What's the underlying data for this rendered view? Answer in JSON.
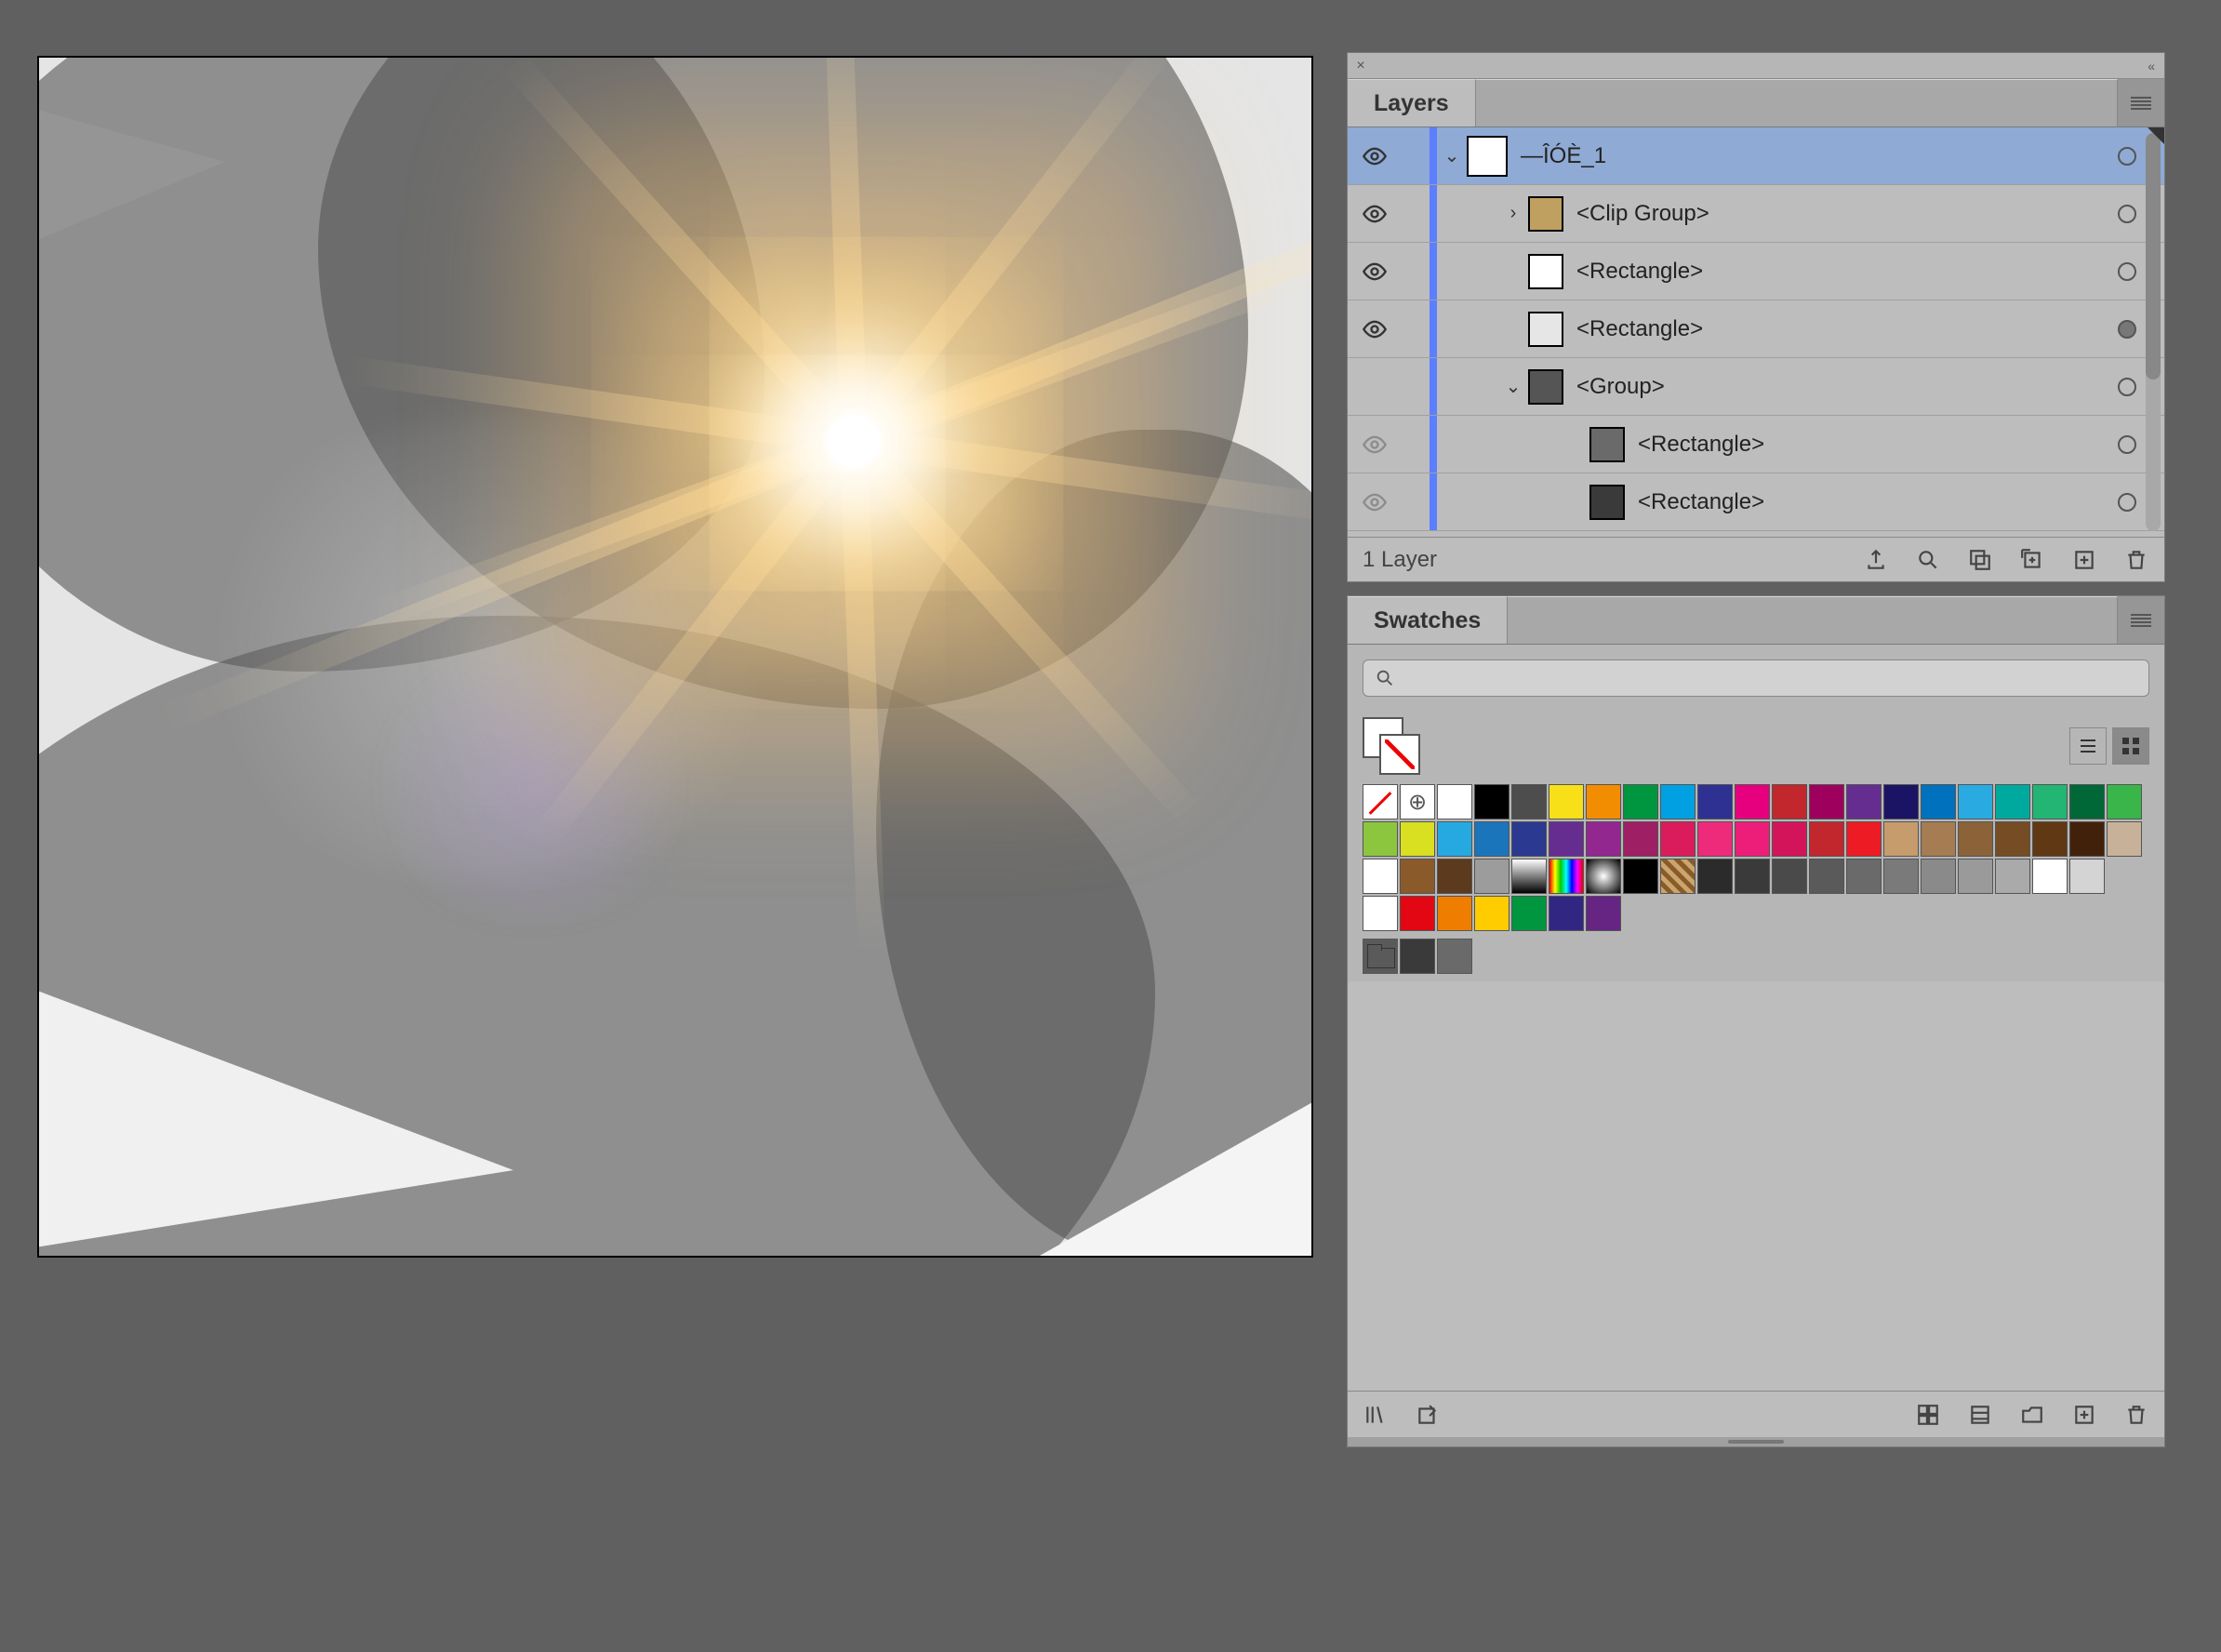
{
  "panels": {
    "layers": {
      "tab_label": "Layers",
      "footer_text": "1 Layer",
      "rows": [
        {
          "name": "—ÎÓÈ_1",
          "indent": 0,
          "disclosure": "open",
          "visible": true,
          "target": "empty",
          "selected": true,
          "thumb": "#ffffff"
        },
        {
          "name": "<Clip Group>",
          "indent": 1,
          "disclosure": "closed",
          "visible": true,
          "target": "empty",
          "selected": false,
          "thumb": "#c0a060"
        },
        {
          "name": "<Rectangle>",
          "indent": 1,
          "disclosure": "none",
          "visible": true,
          "target": "empty",
          "selected": false,
          "thumb": "#ffffff"
        },
        {
          "name": "<Rectangle>",
          "indent": 1,
          "disclosure": "none",
          "visible": true,
          "target": "filled",
          "selected": false,
          "thumb": "#e6e6e6"
        },
        {
          "name": "<Group>",
          "indent": 1,
          "disclosure": "open",
          "visible": false,
          "target": "empty",
          "selected": false,
          "thumb": "#555555"
        },
        {
          "name": "<Rectangle>",
          "indent": 2,
          "disclosure": "none",
          "visible": "dim",
          "target": "empty",
          "selected": false,
          "thumb": "#6a6a6a"
        },
        {
          "name": "<Rectangle>",
          "indent": 2,
          "disclosure": "none",
          "visible": "dim",
          "target": "empty",
          "selected": false,
          "thumb": "#3a3a3a"
        }
      ]
    },
    "swatches": {
      "tab_label": "Swatches",
      "search_placeholder": "",
      "colors_row1": [
        "none",
        "reg",
        "#ffffff",
        "#000000",
        "#4d4d4d",
        "#f7e017",
        "#f28c00",
        "#009640",
        "#00a0e3",
        "#2e3192",
        "#e6007e",
        "#c1272d",
        "#9e005d",
        "#662d91",
        "#1b1464",
        "#0071bc",
        "#29abe2",
        "#00a99d",
        "#22b573",
        "#006837",
        "#39b54a"
      ],
      "colors_row2": [
        "#8cc63f",
        "#d9e021",
        "#26a9e0",
        "#1b75bb",
        "#2b3990",
        "#662d91",
        "#92278f",
        "#9e1f63",
        "#da1c5c",
        "#ee2a7b",
        "#ed1e79",
        "#d4145a",
        "#c1272d",
        "#ed1c24",
        "#c69c6d",
        "#a67c52",
        "#8c6239",
        "#754c24",
        "#603813",
        "#42210b",
        "#c7b299"
      ],
      "colors_row3": [
        "#ffffff",
        "#8b5a2b",
        "#5c3a1e",
        "#9c9c9c",
        "grad1",
        "grad2",
        "grad3",
        "#000000",
        "pat",
        "#2b2b2b",
        "#3a3a3a",
        "#4a4a4a",
        "#5a5a5a",
        "#6a6a6a",
        "#7a7a7a",
        "#8a8a8a",
        "#9a9a9a",
        "#aaaaaa",
        "#ffffff",
        "#d4d4d4"
      ],
      "colors_row4": [
        "#ffffff",
        "#e30613",
        "#ef7d00",
        "#ffcc00",
        "#009640",
        "#312783",
        "#662483"
      ],
      "group_row": [
        "folder",
        "#3a3a3a",
        "#6a6a6a"
      ]
    }
  }
}
